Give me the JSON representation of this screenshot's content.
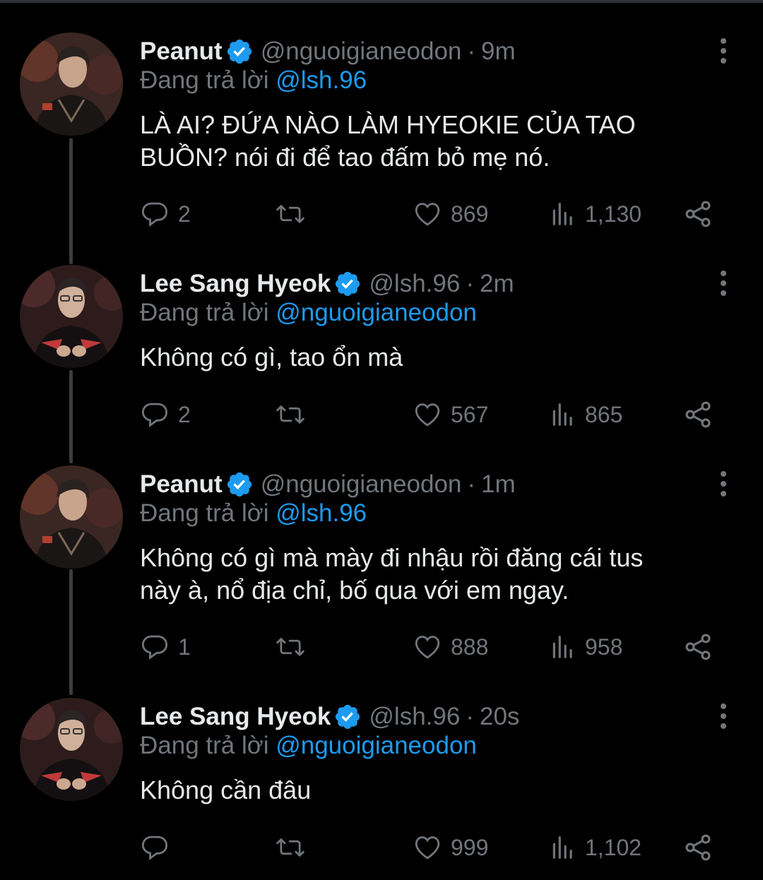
{
  "tweets": [
    {
      "name": "Peanut",
      "handle": "@nguoigianeodon",
      "time": "9m",
      "reply_prefix": "Đang trả lời",
      "reply_to": "@lsh.96",
      "text_lines": [
        "LÀ AI? ĐỨA NÀO LÀM HYEOKIE CỦA TAO",
        "BUỒN? nói đi để tao đấm bỏ mẹ nó."
      ],
      "replies": "2",
      "retweets": "",
      "likes": "869",
      "views": "1,130"
    },
    {
      "name": "Lee Sang Hyeok",
      "handle": "@lsh.96",
      "time": "2m",
      "reply_prefix": "Đang trả lời",
      "reply_to": "@nguoigianeodon",
      "text_lines": [
        "Không có gì, tao ổn mà"
      ],
      "replies": "2",
      "retweets": "",
      "likes": "567",
      "views": "865"
    },
    {
      "name": "Peanut",
      "handle": "@nguoigianeodon",
      "time": "1m",
      "reply_prefix": "Đang trả lời",
      "reply_to": "@lsh.96",
      "text_lines": [
        "Không có gì mà mày đi nhậu rồi đăng cái tus",
        "này à, nổ địa chỉ, bố qua với em ngay."
      ],
      "replies": "1",
      "retweets": "",
      "likes": "888",
      "views": "958"
    },
    {
      "name": "Lee Sang Hyeok",
      "handle": "@lsh.96",
      "time": "20s",
      "reply_prefix": "Đang trả lời",
      "reply_to": "@nguoigianeodon",
      "text_lines": [
        "Không cần đâu"
      ],
      "replies": "",
      "retweets": "",
      "likes": "999",
      "views": "1,102"
    }
  ],
  "colors": {
    "background": "#000000",
    "text": "#e7e9ea",
    "secondary": "#71767b",
    "accent": "#1d9bf0",
    "thread_line": "#3a3d41"
  },
  "icons": [
    "verified-badge-icon",
    "more-options-icon",
    "reply-icon",
    "retweet-icon",
    "like-icon",
    "views-icon",
    "share-icon"
  ],
  "separator": "·"
}
